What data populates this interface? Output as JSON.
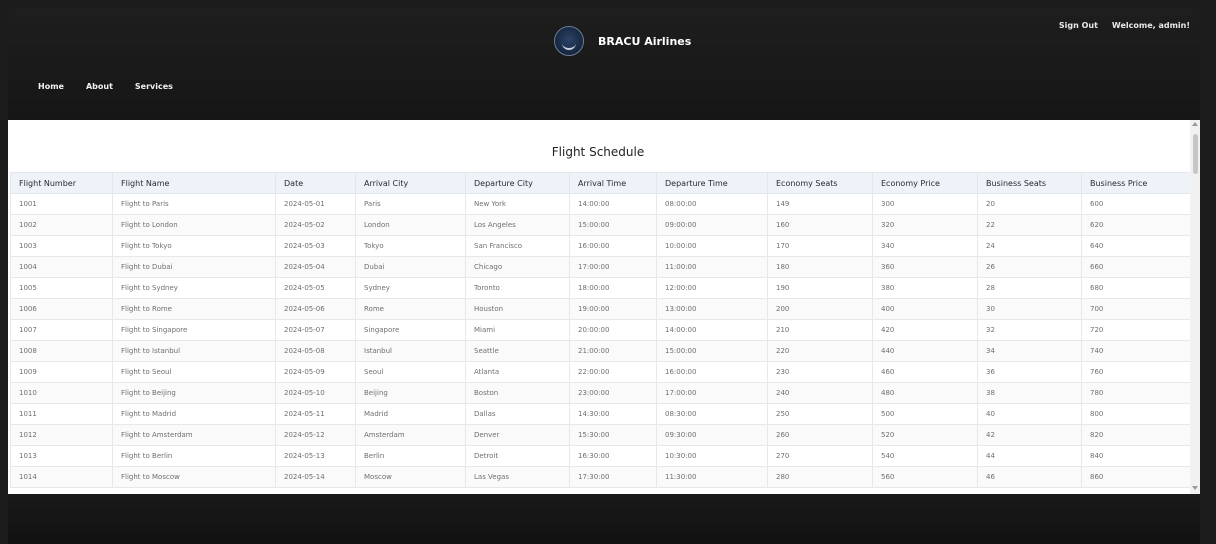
{
  "header": {
    "brand_name": "BRACU Airlines",
    "sign_out_label": "Sign Out",
    "welcome_text": "Welcome, admin!",
    "nav": [
      "Home",
      "About",
      "Services"
    ]
  },
  "main": {
    "title": "Flight Schedule",
    "columns": [
      "Flight Number",
      "Flight Name",
      "Date",
      "Arrival City",
      "Departure City",
      "Arrival Time",
      "Departure Time",
      "Economy Seats",
      "Economy Price",
      "Business Seats",
      "Business Price"
    ],
    "rows": [
      [
        "1001",
        "Flight to Paris",
        "2024-05-01",
        "Paris",
        "New York",
        "14:00:00",
        "08:00:00",
        "149",
        "300",
        "20",
        "600"
      ],
      [
        "1002",
        "Flight to London",
        "2024-05-02",
        "London",
        "Los Angeles",
        "15:00:00",
        "09:00:00",
        "160",
        "320",
        "22",
        "620"
      ],
      [
        "1003",
        "Flight to Tokyo",
        "2024-05-03",
        "Tokyo",
        "San Francisco",
        "16:00:00",
        "10:00:00",
        "170",
        "340",
        "24",
        "640"
      ],
      [
        "1004",
        "Flight to Dubai",
        "2024-05-04",
        "Dubai",
        "Chicago",
        "17:00:00",
        "11:00:00",
        "180",
        "360",
        "26",
        "660"
      ],
      [
        "1005",
        "Flight to Sydney",
        "2024-05-05",
        "Sydney",
        "Toronto",
        "18:00:00",
        "12:00:00",
        "190",
        "380",
        "28",
        "680"
      ],
      [
        "1006",
        "Flight to Rome",
        "2024-05-06",
        "Rome",
        "Houston",
        "19:00:00",
        "13:00:00",
        "200",
        "400",
        "30",
        "700"
      ],
      [
        "1007",
        "Flight to Singapore",
        "2024-05-07",
        "Singapore",
        "Miami",
        "20:00:00",
        "14:00:00",
        "210",
        "420",
        "32",
        "720"
      ],
      [
        "1008",
        "Flight to Istanbul",
        "2024-05-08",
        "Istanbul",
        "Seattle",
        "21:00:00",
        "15:00:00",
        "220",
        "440",
        "34",
        "740"
      ],
      [
        "1009",
        "Flight to Seoul",
        "2024-05-09",
        "Seoul",
        "Atlanta",
        "22:00:00",
        "16:00:00",
        "230",
        "460",
        "36",
        "760"
      ],
      [
        "1010",
        "Flight to Beijing",
        "2024-05-10",
        "Beijing",
        "Boston",
        "23:00:00",
        "17:00:00",
        "240",
        "480",
        "38",
        "780"
      ],
      [
        "1011",
        "Flight to Madrid",
        "2024-05-11",
        "Madrid",
        "Dallas",
        "14:30:00",
        "08:30:00",
        "250",
        "500",
        "40",
        "800"
      ],
      [
        "1012",
        "Flight to Amsterdam",
        "2024-05-12",
        "Amsterdam",
        "Denver",
        "15:30:00",
        "09:30:00",
        "260",
        "520",
        "42",
        "820"
      ],
      [
        "1013",
        "Flight to Berlin",
        "2024-05-13",
        "Berlin",
        "Detroit",
        "16:30:00",
        "10:30:00",
        "270",
        "540",
        "44",
        "840"
      ],
      [
        "1014",
        "Flight to Moscow",
        "2024-05-14",
        "Moscow",
        "Las Vegas",
        "17:30:00",
        "11:30:00",
        "280",
        "560",
        "46",
        "860"
      ]
    ]
  }
}
